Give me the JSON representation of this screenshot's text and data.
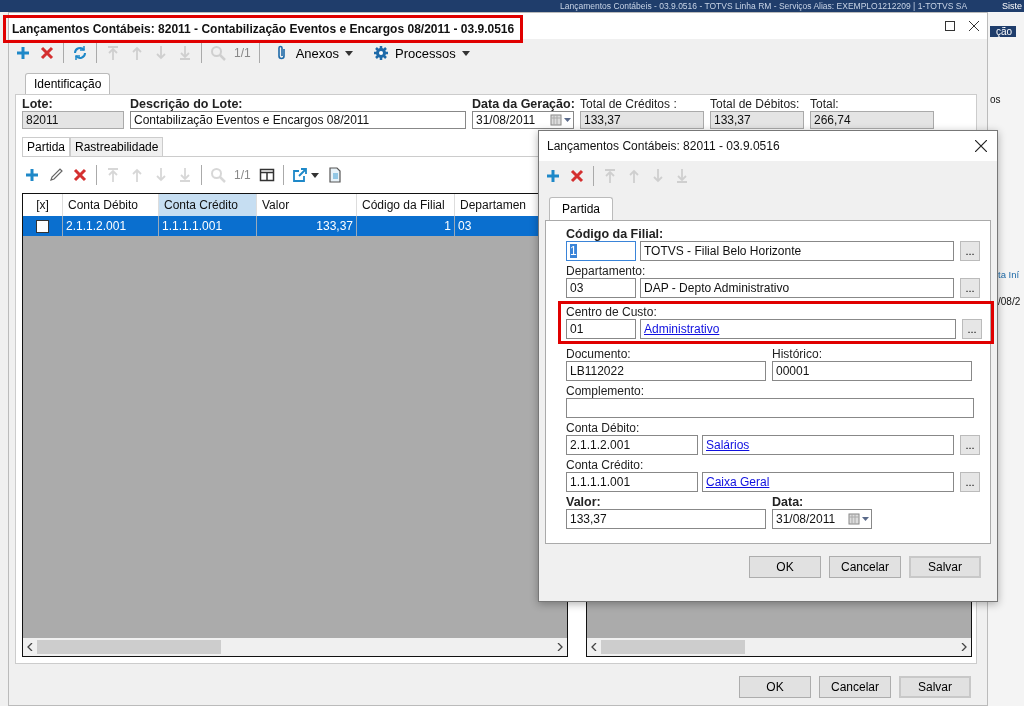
{
  "background_app": {
    "title": "Lançamentos Contábeis - 03.9.0516 - TOTVS Linha RM - Serviços  Alias: EXEMPLO1212209 | 1-TOTVS SA",
    "corner_text": "Siste",
    "side_texts": [
      "ção",
      "os",
      "ta Iní",
      "/08/2"
    ]
  },
  "window": {
    "title": "Lançamentos Contábeis: 82011 - Contabilização Eventos e Encargos 08/2011 - 03.9.0516",
    "highlighted": true,
    "toolbar": [
      {
        "kind": "add",
        "disabled": false
      },
      {
        "kind": "delete",
        "disabled": false
      },
      {
        "kind": "separator"
      },
      {
        "kind": "refresh",
        "disabled": false
      },
      {
        "kind": "separator"
      },
      {
        "kind": "first",
        "disabled": true
      },
      {
        "kind": "up",
        "disabled": true
      },
      {
        "kind": "down",
        "disabled": true
      },
      {
        "kind": "last",
        "disabled": true
      },
      {
        "kind": "separator"
      },
      {
        "kind": "search",
        "disabled": true
      },
      {
        "kind": "counter",
        "label": "1/1"
      },
      {
        "kind": "separator"
      },
      {
        "kind": "attachments",
        "label": "Anexos"
      },
      {
        "kind": "processes",
        "label": "Processos"
      }
    ],
    "tabs": [
      {
        "label": "Identificação",
        "selected": true
      }
    ],
    "header_fields": [
      {
        "label": "Lote:",
        "bold": true,
        "value": "82011",
        "readonly": true,
        "kind": "text"
      },
      {
        "label": "Descrição do Lote:",
        "bold": true,
        "value": "Contabilização Eventos e Encargos 08/2011",
        "readonly": false,
        "kind": "text"
      },
      {
        "label": "Data da Geração:",
        "bold": true,
        "value": "31/08/2011",
        "readonly": false,
        "kind": "date"
      },
      {
        "label": "Total de Créditos :",
        "bold": false,
        "value": "133,37",
        "readonly": true,
        "kind": "text"
      },
      {
        "label": "Total de Débitos:",
        "bold": false,
        "value": "133,37",
        "readonly": true,
        "kind": "text"
      },
      {
        "label": "Total:",
        "bold": false,
        "value": "266,74",
        "readonly": true,
        "kind": "text"
      }
    ],
    "inner_tabs": [
      {
        "label": "Partida",
        "selected": true
      },
      {
        "label": "Rastreabilidade",
        "selected": false
      }
    ],
    "inner_toolbar": [
      {
        "kind": "add",
        "disabled": false
      },
      {
        "kind": "edit",
        "disabled": false
      },
      {
        "kind": "delete",
        "disabled": false
      },
      {
        "kind": "separator"
      },
      {
        "kind": "first",
        "disabled": true
      },
      {
        "kind": "up",
        "disabled": true
      },
      {
        "kind": "down",
        "disabled": true
      },
      {
        "kind": "last",
        "disabled": true
      },
      {
        "kind": "separator"
      },
      {
        "kind": "search",
        "disabled": true
      },
      {
        "kind": "counter",
        "label": "1/1"
      },
      {
        "kind": "columns",
        "disabled": false
      },
      {
        "kind": "separator"
      },
      {
        "kind": "export",
        "disabled": false
      },
      {
        "kind": "document",
        "disabled": false
      }
    ],
    "table": {
      "columns": [
        {
          "label": "[x]",
          "sorted": false
        },
        {
          "label": "Conta Débito",
          "sorted": false
        },
        {
          "label": "Conta Crédito",
          "sorted": true
        },
        {
          "label": "Valor",
          "sorted": false
        },
        {
          "label": "Código da Filial",
          "sorted": false
        },
        {
          "label": "Departamen",
          "sorted": false
        }
      ],
      "rows": [
        {
          "selected": true,
          "cells": [
            {
              "kind": "checkbox",
              "checked": false
            },
            {
              "kind": "text",
              "text": "2.1.1.2.001"
            },
            {
              "kind": "text",
              "text": "1.1.1.1.001"
            },
            {
              "kind": "number",
              "text": "133,37"
            },
            {
              "kind": "number",
              "text": "1"
            },
            {
              "kind": "text",
              "text": "03"
            }
          ]
        }
      ]
    },
    "buttons": [
      {
        "label": "OK",
        "default": false
      },
      {
        "label": "Cancelar",
        "default": false
      },
      {
        "label": "Salvar",
        "default": true
      }
    ]
  },
  "dialog": {
    "title": "Lançamentos Contábeis: 82011 - 03.9.0516",
    "toolbar": [
      {
        "kind": "add",
        "disabled": false
      },
      {
        "kind": "delete",
        "disabled": false
      },
      {
        "kind": "separator"
      },
      {
        "kind": "first",
        "disabled": true
      },
      {
        "kind": "up",
        "disabled": true
      },
      {
        "kind": "down",
        "disabled": true
      },
      {
        "kind": "last",
        "disabled": true
      }
    ],
    "tabs": [
      {
        "label": "Partida",
        "selected": true
      }
    ],
    "rows": [
      {
        "kind": "lookup",
        "label": "Código da Filial:",
        "bold": true,
        "code": "1",
        "description": "TOTVS - Filial Belo Horizonte",
        "focused": true,
        "link": false,
        "highlighted": false,
        "button": "..."
      },
      {
        "kind": "lookup",
        "label": "Departamento:",
        "bold": false,
        "code": "03",
        "description": "DAP - Depto Administrativo",
        "focused": false,
        "link": false,
        "highlighted": false,
        "button": "..."
      },
      {
        "kind": "lookup",
        "label": "Centro de Custo:",
        "bold": false,
        "code": "01",
        "description": "Administrativo",
        "focused": false,
        "link": true,
        "highlighted": true,
        "button": "..."
      },
      {
        "kind": "pair",
        "fields": [
          {
            "kind": "text",
            "label": "Documento:",
            "bold": false,
            "value": "LB112022"
          },
          {
            "kind": "text",
            "label": "Histórico:",
            "bold": false,
            "value": "00001"
          }
        ]
      },
      {
        "kind": "text",
        "label": "Complemento:",
        "bold": false
      },
      {
        "kind": "lookup",
        "label": "Conta Débito:",
        "bold": false,
        "code": "2.1.1.2.001",
        "description": "Salários",
        "focused": false,
        "link": true,
        "highlighted": false,
        "button": "...",
        "wide": true
      },
      {
        "kind": "lookup",
        "label": "Conta Crédito:",
        "bold": false,
        "code": "1.1.1.1.001",
        "description": "Caixa Geral",
        "focused": false,
        "link": true,
        "highlighted": false,
        "button": "...",
        "wide": true
      },
      {
        "kind": "pair",
        "fields": [
          {
            "kind": "text",
            "label": "Valor:",
            "bold": true,
            "value": "133,37"
          },
          {
            "kind": "date",
            "label": "Data:",
            "bold": true,
            "value": "31/08/2011"
          }
        ]
      }
    ],
    "buttons": [
      {
        "label": "OK",
        "default": false
      },
      {
        "label": "Cancelar",
        "default": false
      },
      {
        "label": "Salvar",
        "default": true
      }
    ]
  }
}
